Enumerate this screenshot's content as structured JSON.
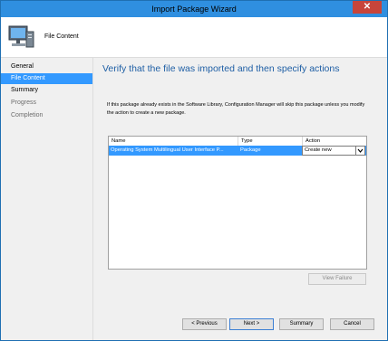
{
  "window": {
    "title": "Import Package Wizard",
    "close_glyph": "✕"
  },
  "header": {
    "title": "File Content",
    "icon": "computer-icon"
  },
  "sidebar": {
    "items": [
      {
        "label": "General",
        "state": "normal"
      },
      {
        "label": "File Content",
        "state": "active"
      },
      {
        "label": "Summary",
        "state": "normal"
      },
      {
        "label": "Progress",
        "state": "disabled"
      },
      {
        "label": "Completion",
        "state": "disabled"
      }
    ]
  },
  "main": {
    "heading": "Verify that the file was imported and then specify actions",
    "info": "If this package already exists in the Software Library, Configuration Manager will skip this package unless you modify the action to create a new package.",
    "grid": {
      "columns": [
        "Name",
        "Type",
        "Action"
      ],
      "rows": [
        {
          "name": "Operating System Multilingual User Interface P...",
          "type": "Package",
          "action": "Create new"
        }
      ]
    },
    "view_failure_label": "View Failure"
  },
  "footer": {
    "previous_label": "< Previous",
    "next_label": "Next >",
    "summary_label": "Summary",
    "cancel_label": "Cancel"
  },
  "colors": {
    "titlebar": "#2f8fe0",
    "accent": "#3399ff",
    "heading": "#1f5fa5",
    "close": "#c7453b"
  }
}
